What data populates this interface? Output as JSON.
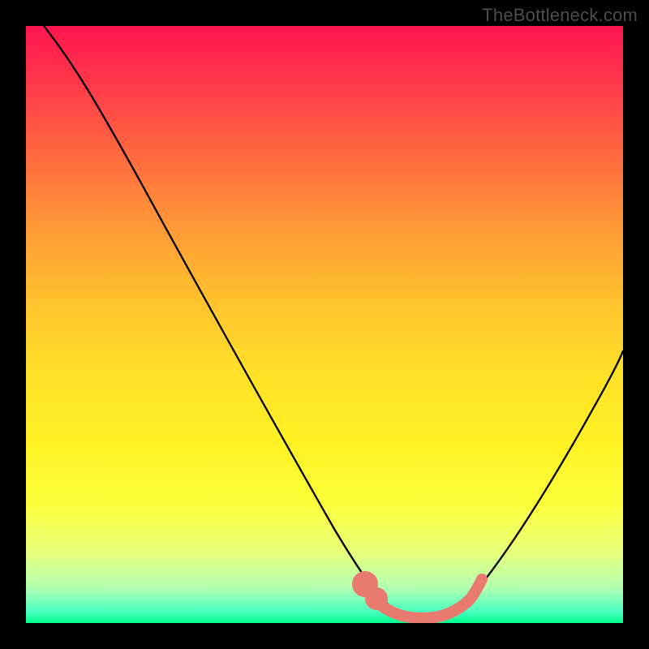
{
  "watermark": "TheBottleneck.com",
  "colors": {
    "background": "#000000",
    "curve": "#000000",
    "highlight": "#e97a6f",
    "gradient_top": "#ff1650",
    "gradient_mid": "#ffe028",
    "gradient_bottom": "#00ff8f"
  },
  "chart_data": {
    "type": "line",
    "title": "",
    "xlabel": "",
    "ylabel": "",
    "xlim": [
      0,
      100
    ],
    "ylim": [
      0,
      100
    ],
    "series": [
      {
        "name": "bottleneck-curve",
        "x": [
          3,
          8,
          14,
          20,
          26,
          32,
          38,
          44,
          50,
          55,
          58,
          61,
          64,
          67,
          71,
          76,
          82,
          88,
          94,
          100
        ],
        "y": [
          100,
          94,
          86,
          77,
          68,
          59,
          50,
          40,
          30,
          20,
          13,
          8,
          4,
          2,
          2,
          6,
          14,
          26,
          40,
          56
        ]
      }
    ],
    "highlight": {
      "name": "optimal-range",
      "x": [
        55,
        58,
        61,
        64,
        67,
        71,
        73,
        74,
        75
      ],
      "y": [
        6,
        4,
        3,
        2,
        2,
        2,
        3,
        5,
        7
      ]
    }
  }
}
